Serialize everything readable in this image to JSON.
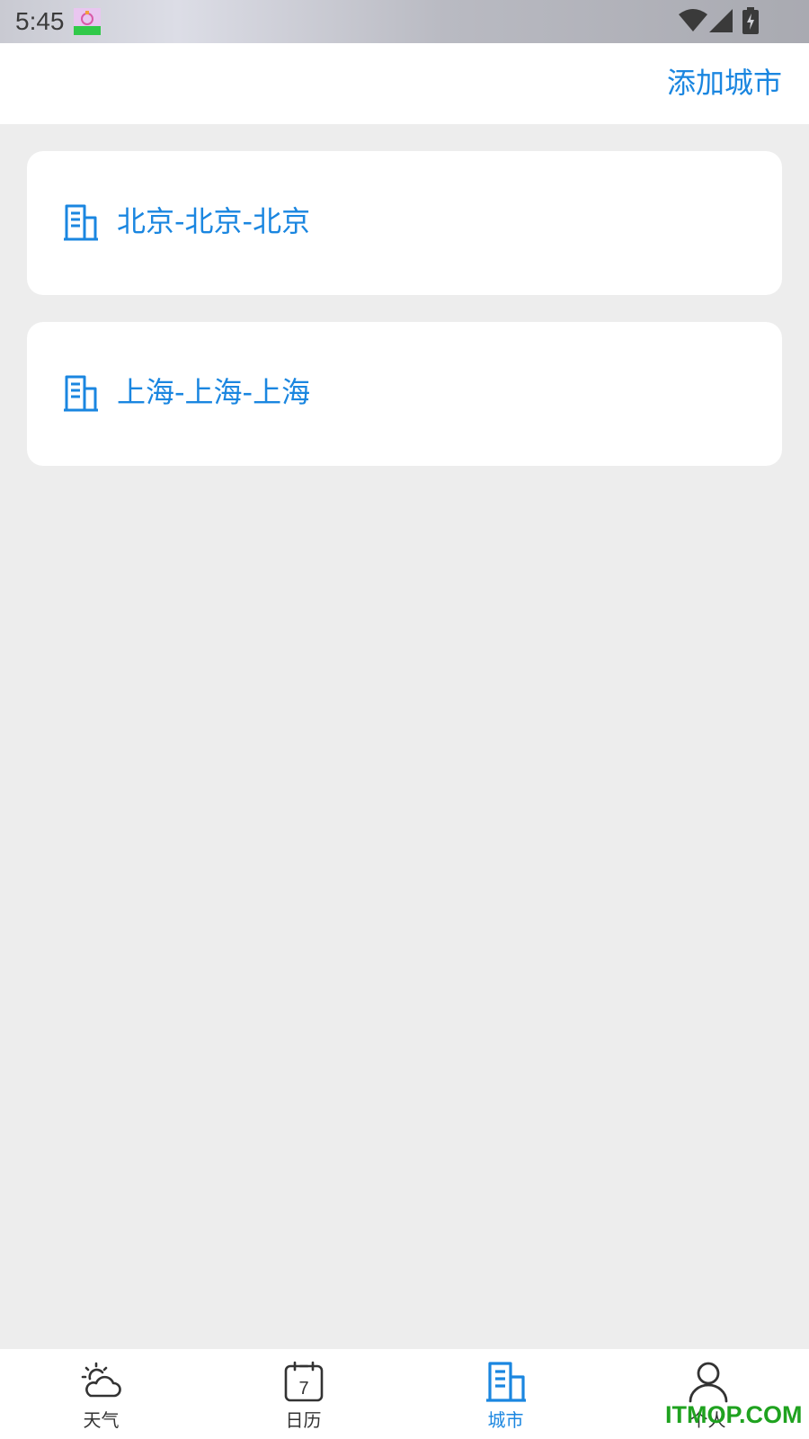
{
  "status_bar": {
    "time": "5:45",
    "icons": [
      "notification-app-icon",
      "wifi-icon",
      "signal-icon",
      "battery-charging-icon"
    ]
  },
  "header": {
    "add_city_label": "添加城市"
  },
  "cities": [
    {
      "label": "北京-北京-北京",
      "icon": "building-icon"
    },
    {
      "label": "上海-上海-上海",
      "icon": "building-icon"
    }
  ],
  "bottom_nav": {
    "items": [
      {
        "label": "天气",
        "icon": "weather-icon",
        "active": false
      },
      {
        "label": "日历",
        "icon": "calendar-icon",
        "calendar_day": "7",
        "active": false
      },
      {
        "label": "城市",
        "icon": "building-icon",
        "active": true
      },
      {
        "label": "个人",
        "icon": "person-icon",
        "active": false
      }
    ]
  },
  "watermark": "ITMOP.COM",
  "colors": {
    "accent": "#1a86e0",
    "background": "#ededed",
    "card": "#ffffff",
    "nav_text": "#333333",
    "watermark": "#1fa21f"
  }
}
